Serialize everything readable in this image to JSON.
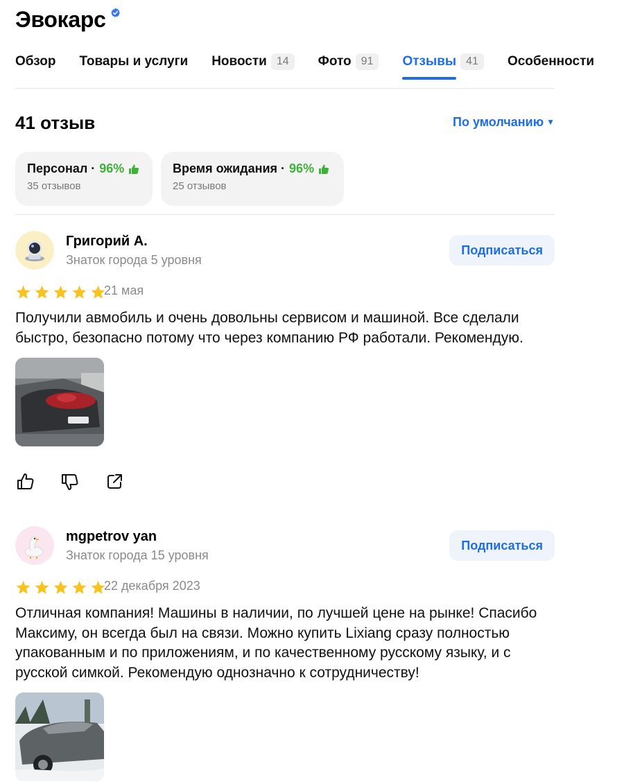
{
  "header": {
    "title": "Эвокарс"
  },
  "tabs": [
    {
      "label": "Обзор",
      "badge": ""
    },
    {
      "label": "Товары и услуги",
      "badge": ""
    },
    {
      "label": "Новости",
      "badge": "14"
    },
    {
      "label": "Фото",
      "badge": "91"
    },
    {
      "label": "Отзывы",
      "badge": "41"
    },
    {
      "label": "Особенности",
      "badge": ""
    }
  ],
  "reviews_header": {
    "count": "41 отзыв",
    "sort_label": "По умолчанию"
  },
  "aspects": [
    {
      "name": "Персонал ·",
      "percent": "96%",
      "sub": "35 отзывов"
    },
    {
      "name": "Время ожидания ·",
      "percent": "96%",
      "sub": "25 отзывов"
    }
  ],
  "reviews": [
    {
      "author": "Григорий А.",
      "level": "Знаток города 5 уровня",
      "subscribe_label": "Подписаться",
      "rating": 5,
      "date": "21 мая",
      "text": "Получили авмобиль и очень довольны сервисом и машиной. Все сделали быстро, безопасно потому что через компанию РФ работали. Рекомендую."
    },
    {
      "author": "mgpetrov yan",
      "level": "Знаток города 15 уровня",
      "subscribe_label": "Подписаться",
      "rating": 5,
      "date": "22 декабря 2023",
      "text": "Отличная компания! Машины в наличии, по лучшей цене на рынке! Спасибо Максиму, он всегда был на связи. Можно купить Lixiang сразу полностью упакованным и по приложениям, и по качественному русскому языку, и с русской симкой. Рекомендую однозначно к сотрудничеству!"
    }
  ],
  "colors": {
    "accent": "#1e6ee8",
    "positive": "#3fb03a",
    "star": "#f7c31e"
  }
}
